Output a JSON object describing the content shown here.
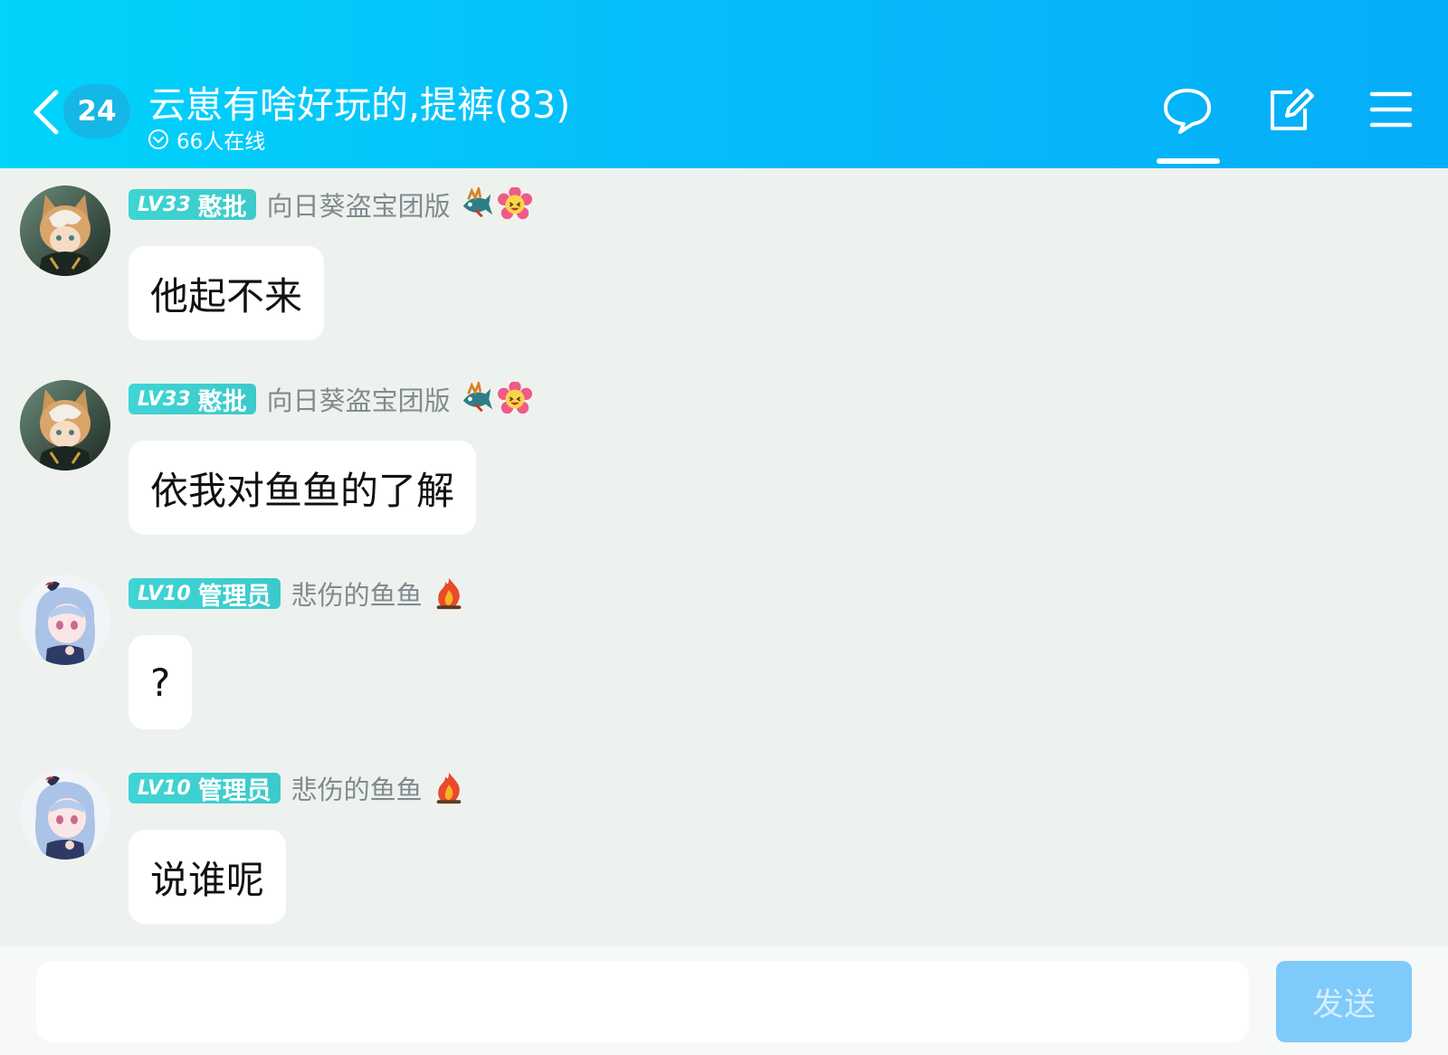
{
  "header": {
    "unread_count": "24",
    "title": "云崽有啥好玩的,提裤(83)",
    "online_text": "66人在线"
  },
  "messages": [
    {
      "level": "LV33",
      "role": "憨批",
      "name": "向日葵盗宝团版",
      "text": "他起不来"
    },
    {
      "level": "LV33",
      "role": "憨批",
      "name": "向日葵盗宝团版",
      "text": "依我对鱼鱼的了解"
    },
    {
      "level": "LV10",
      "role": "管理员",
      "name": "悲伤的鱼鱼",
      "text": "?"
    },
    {
      "level": "LV10",
      "role": "管理员",
      "name": "悲伤的鱼鱼",
      "text": "说谁呢"
    }
  ],
  "input": {
    "placeholder": "",
    "send_label": "发送"
  },
  "colors": {
    "header_start": "#00d4fb",
    "header_end": "#05aef8",
    "level_tag": "#3fd4d5",
    "send_button": "#7ecbfb"
  }
}
